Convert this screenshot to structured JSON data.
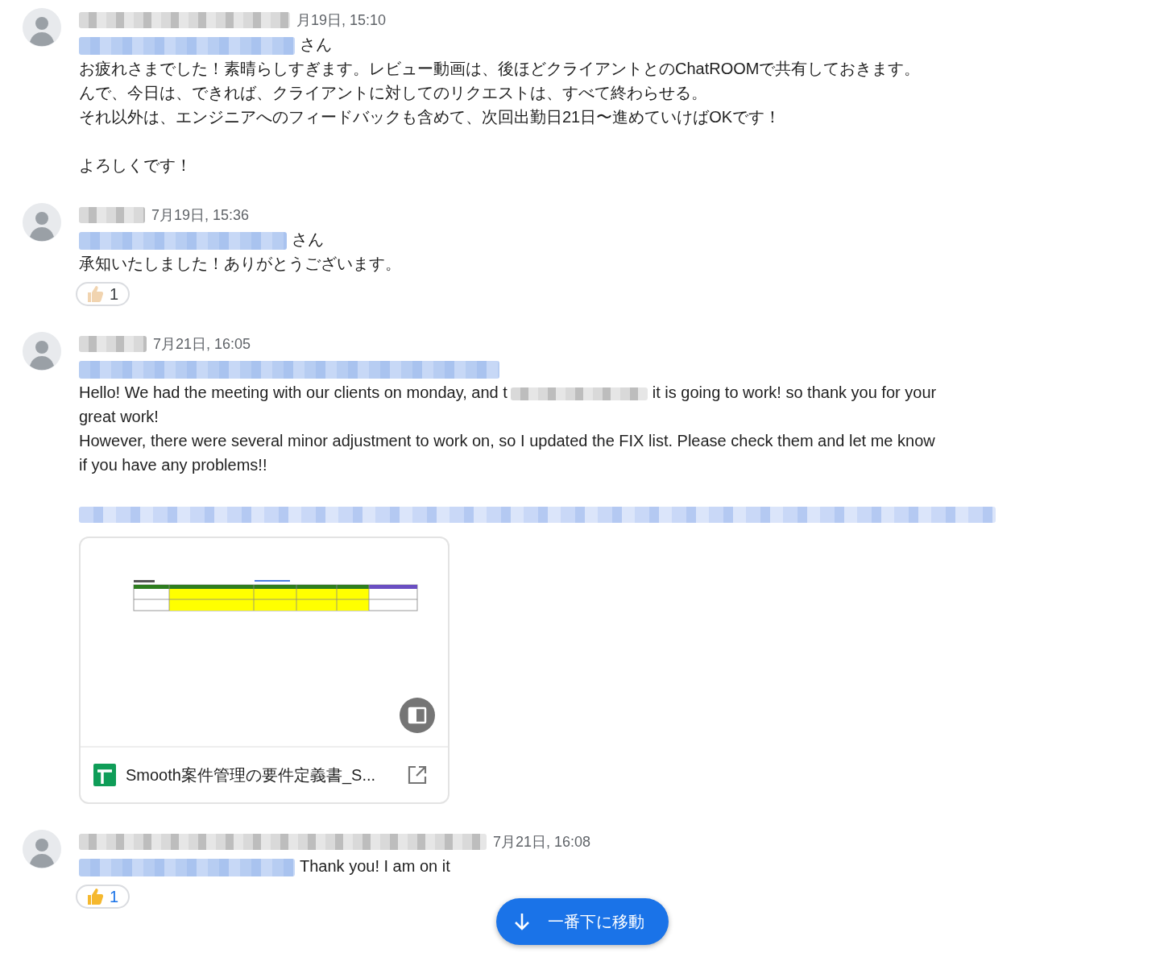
{
  "messages": [
    {
      "time": "月19日, 15:10",
      "blocks": [
        {
          "kind": "line",
          "parts": [
            {
              "kind": "mention"
            },
            {
              "kind": "text",
              "text": "さん"
            }
          ]
        },
        {
          "kind": "line",
          "parts": [
            {
              "kind": "text",
              "text": "お疲れさまでした！素晴らしすぎます。レビュー動画は、後ほどクライアントとのChatROOMで共有しておきます。"
            }
          ]
        },
        {
          "kind": "line",
          "parts": [
            {
              "kind": "text",
              "text": "んで、今日は、できれば、クライアントに対してのリクエストは、すべて終わらせる。"
            }
          ]
        },
        {
          "kind": "line",
          "parts": [
            {
              "kind": "text",
              "text": "それ以外は、エンジニアへのフィードバックも含めて、次回出勤日21日〜進めていけばOKです！"
            }
          ]
        },
        {
          "kind": "gap"
        },
        {
          "kind": "line",
          "parts": [
            {
              "kind": "text",
              "text": "よろしくです！"
            }
          ]
        }
      ]
    },
    {
      "time": "7月19日, 15:36",
      "blocks": [
        {
          "kind": "line",
          "parts": [
            {
              "kind": "mention"
            },
            {
              "kind": "text",
              "text": "さん"
            }
          ]
        },
        {
          "kind": "line",
          "parts": [
            {
              "kind": "text",
              "text": "承知いたしました！ありがとうございます。"
            }
          ]
        }
      ],
      "reaction": {
        "count": "1",
        "selected": false,
        "color": "#f1d4b0"
      }
    },
    {
      "time": "7月21日, 16:05",
      "blocks": [
        {
          "kind": "line",
          "parts": [
            {
              "kind": "mention"
            }
          ]
        },
        {
          "kind": "line",
          "parts": [
            {
              "kind": "text",
              "text": "Hello! We had the meeting with our clients on monday, and t"
            },
            {
              "kind": "redacted"
            },
            {
              "kind": "text",
              "text": "it is going to work! so thank you for your"
            }
          ]
        },
        {
          "kind": "line",
          "parts": [
            {
              "kind": "text",
              "text": "great work!"
            }
          ]
        },
        {
          "kind": "line",
          "parts": [
            {
              "kind": "text",
              "text": "However, there were several minor adjustment to work on, so I updated the FIX list. Please check them and let me know"
            }
          ]
        },
        {
          "kind": "line",
          "parts": [
            {
              "kind": "text",
              "text": "if you have any problems!!"
            }
          ]
        },
        {
          "kind": "gap"
        },
        {
          "kind": "line",
          "parts": [
            {
              "kind": "link"
            }
          ]
        }
      ],
      "attachment": {
        "title": "Smooth案件管理の要件定義書_S..."
      }
    },
    {
      "time": "7月21日, 16:08",
      "blocks": [
        {
          "kind": "line",
          "parts": [
            {
              "kind": "mention"
            },
            {
              "kind": "text",
              "text": "Thank you! I am on it"
            }
          ]
        }
      ],
      "reaction": {
        "count": "1",
        "selected": true,
        "color": "#f5b82e"
      }
    }
  ],
  "jump_button": {
    "label": "一番下に移動"
  }
}
